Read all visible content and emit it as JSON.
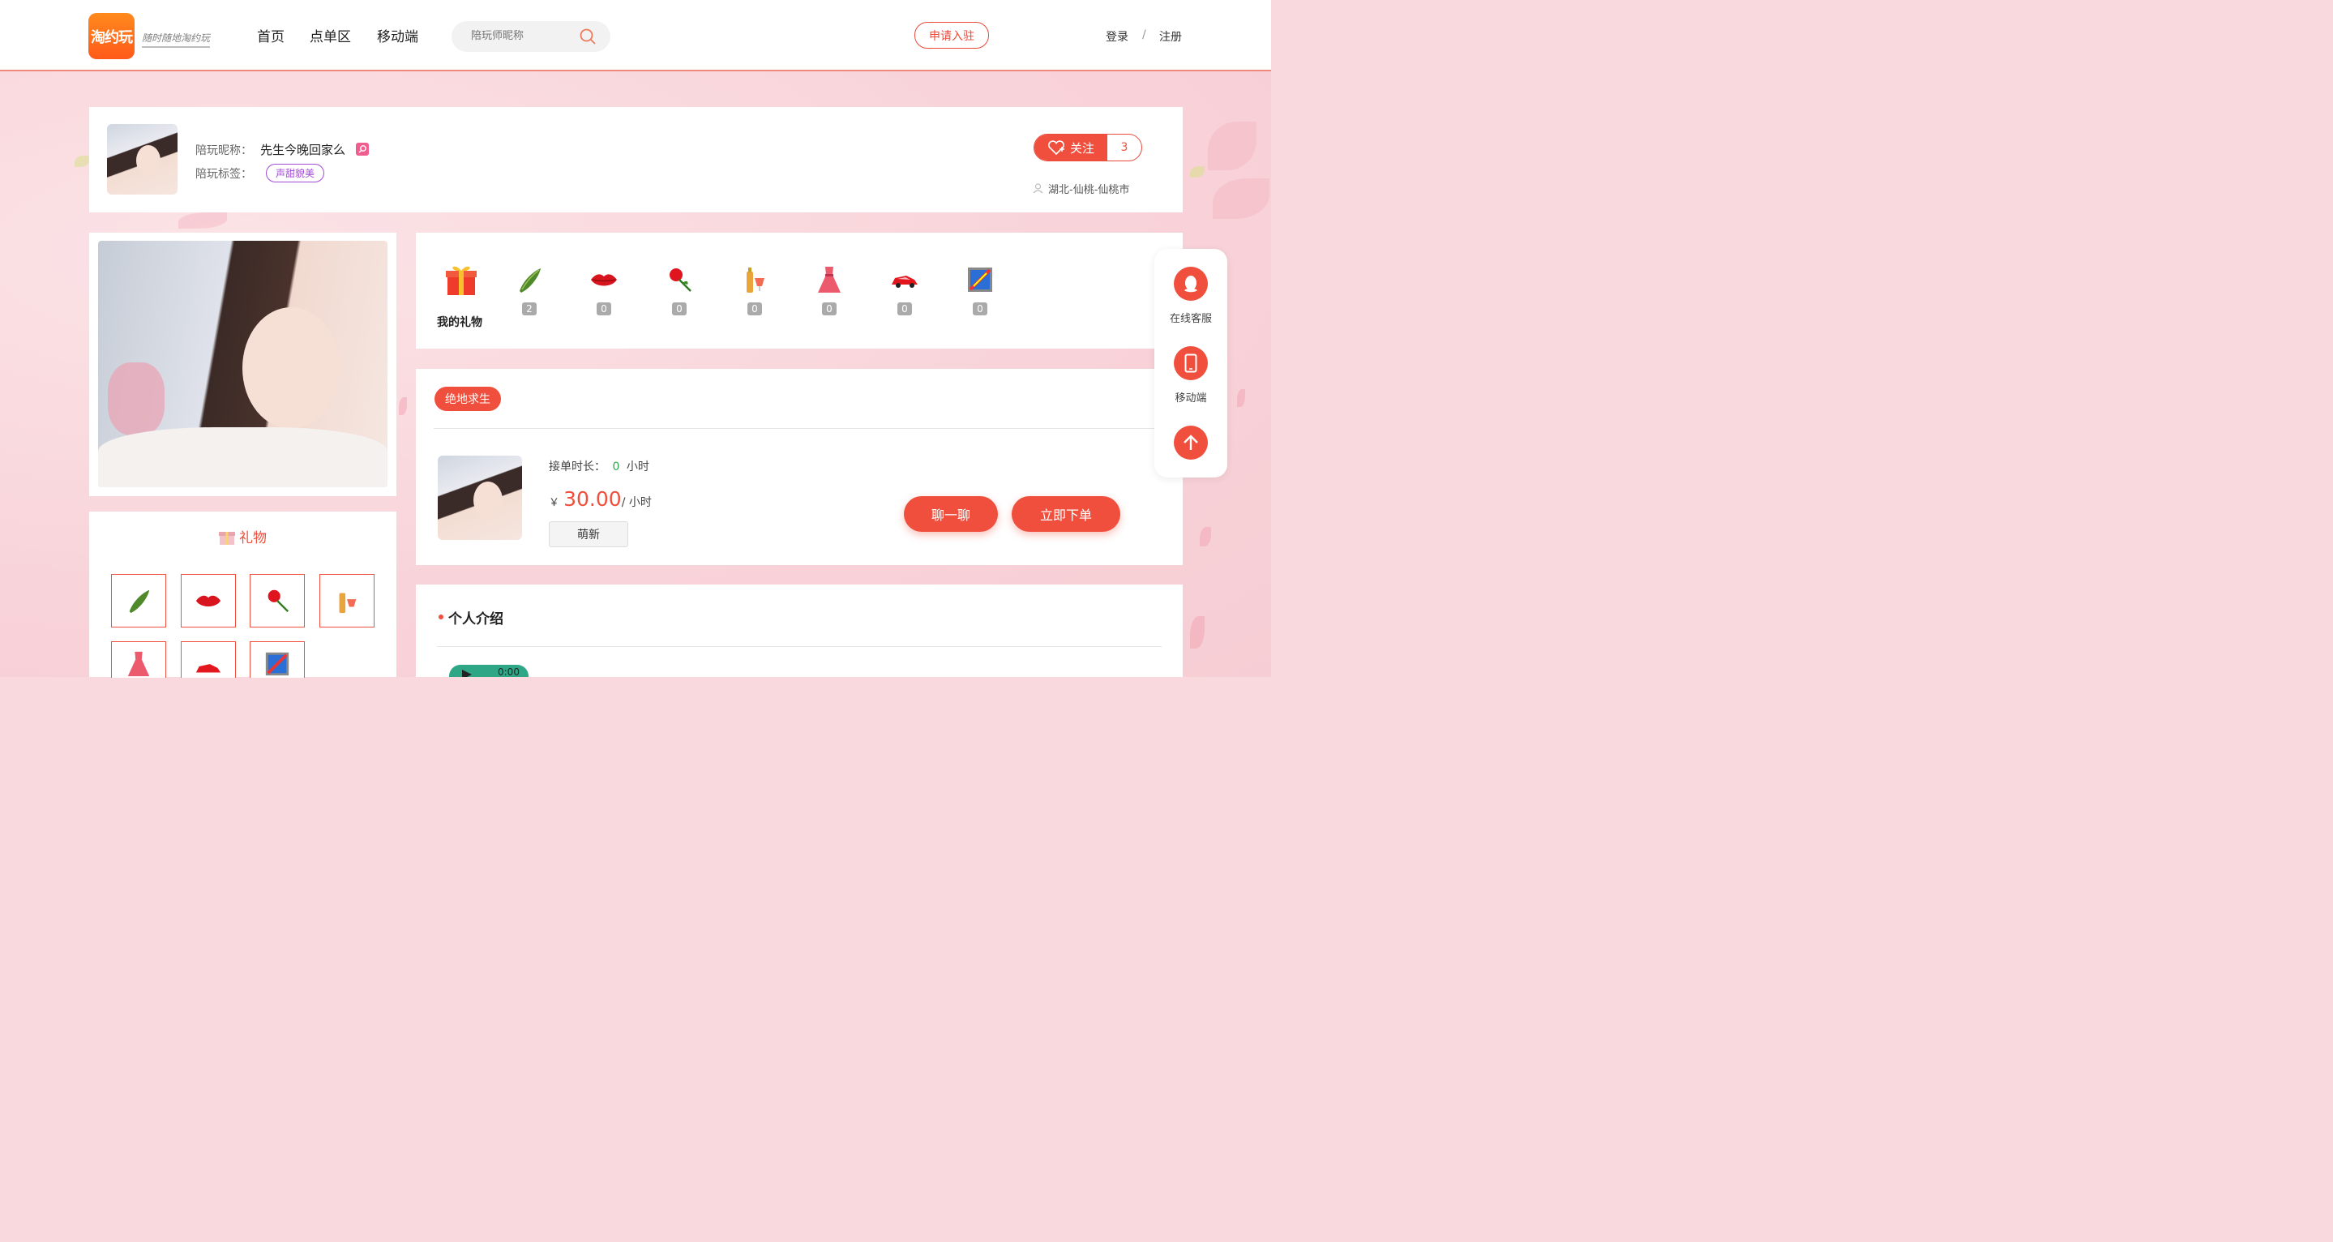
{
  "header": {
    "logo_text": "淘约玩",
    "slogan": "随时随地淘约玩",
    "nav": [
      "首页",
      "点单区",
      "移动端"
    ],
    "search_placeholder": "陪玩师昵称",
    "apply_label": "申请入驻",
    "login_label": "登录",
    "divider": "/",
    "register_label": "注册"
  },
  "profile": {
    "nickname_label": "陪玩昵称：",
    "nickname": "先生今晚回家么",
    "tag_label": "陪玩标签：",
    "tag": "声甜貌美",
    "follow_label": "关注",
    "follow_count": "3",
    "location": "湖北-仙桃-仙桃市"
  },
  "gifts_bar": {
    "title": "我的礼物",
    "items": [
      {
        "icon": "cucumber-icon",
        "count": "2"
      },
      {
        "icon": "lips-icon",
        "count": "0"
      },
      {
        "icon": "rose-icon",
        "count": "0"
      },
      {
        "icon": "champagne-icon",
        "count": "0"
      },
      {
        "icon": "dress-icon",
        "count": "0"
      },
      {
        "icon": "car-icon",
        "count": "0"
      },
      {
        "icon": "painting-icon",
        "count": "0"
      }
    ]
  },
  "service": {
    "game": "绝地求生",
    "duration_label": "接单时长：",
    "duration_value": "0",
    "duration_unit": "小时",
    "currency": "￥",
    "price": "30.00",
    "price_unit": "/ 小时",
    "level": "萌新",
    "chat_label": "聊一聊",
    "order_label": "立即下单"
  },
  "gift_panel": {
    "title": "礼物"
  },
  "intro": {
    "title": "个人介绍",
    "audio_time": "0:00"
  },
  "sidebar": {
    "service_label": "在线客服",
    "mobile_label": "移动端"
  },
  "colors": {
    "accent": "#ef4f3c",
    "tag": "#a24bd6",
    "green": "#2aa84a"
  }
}
